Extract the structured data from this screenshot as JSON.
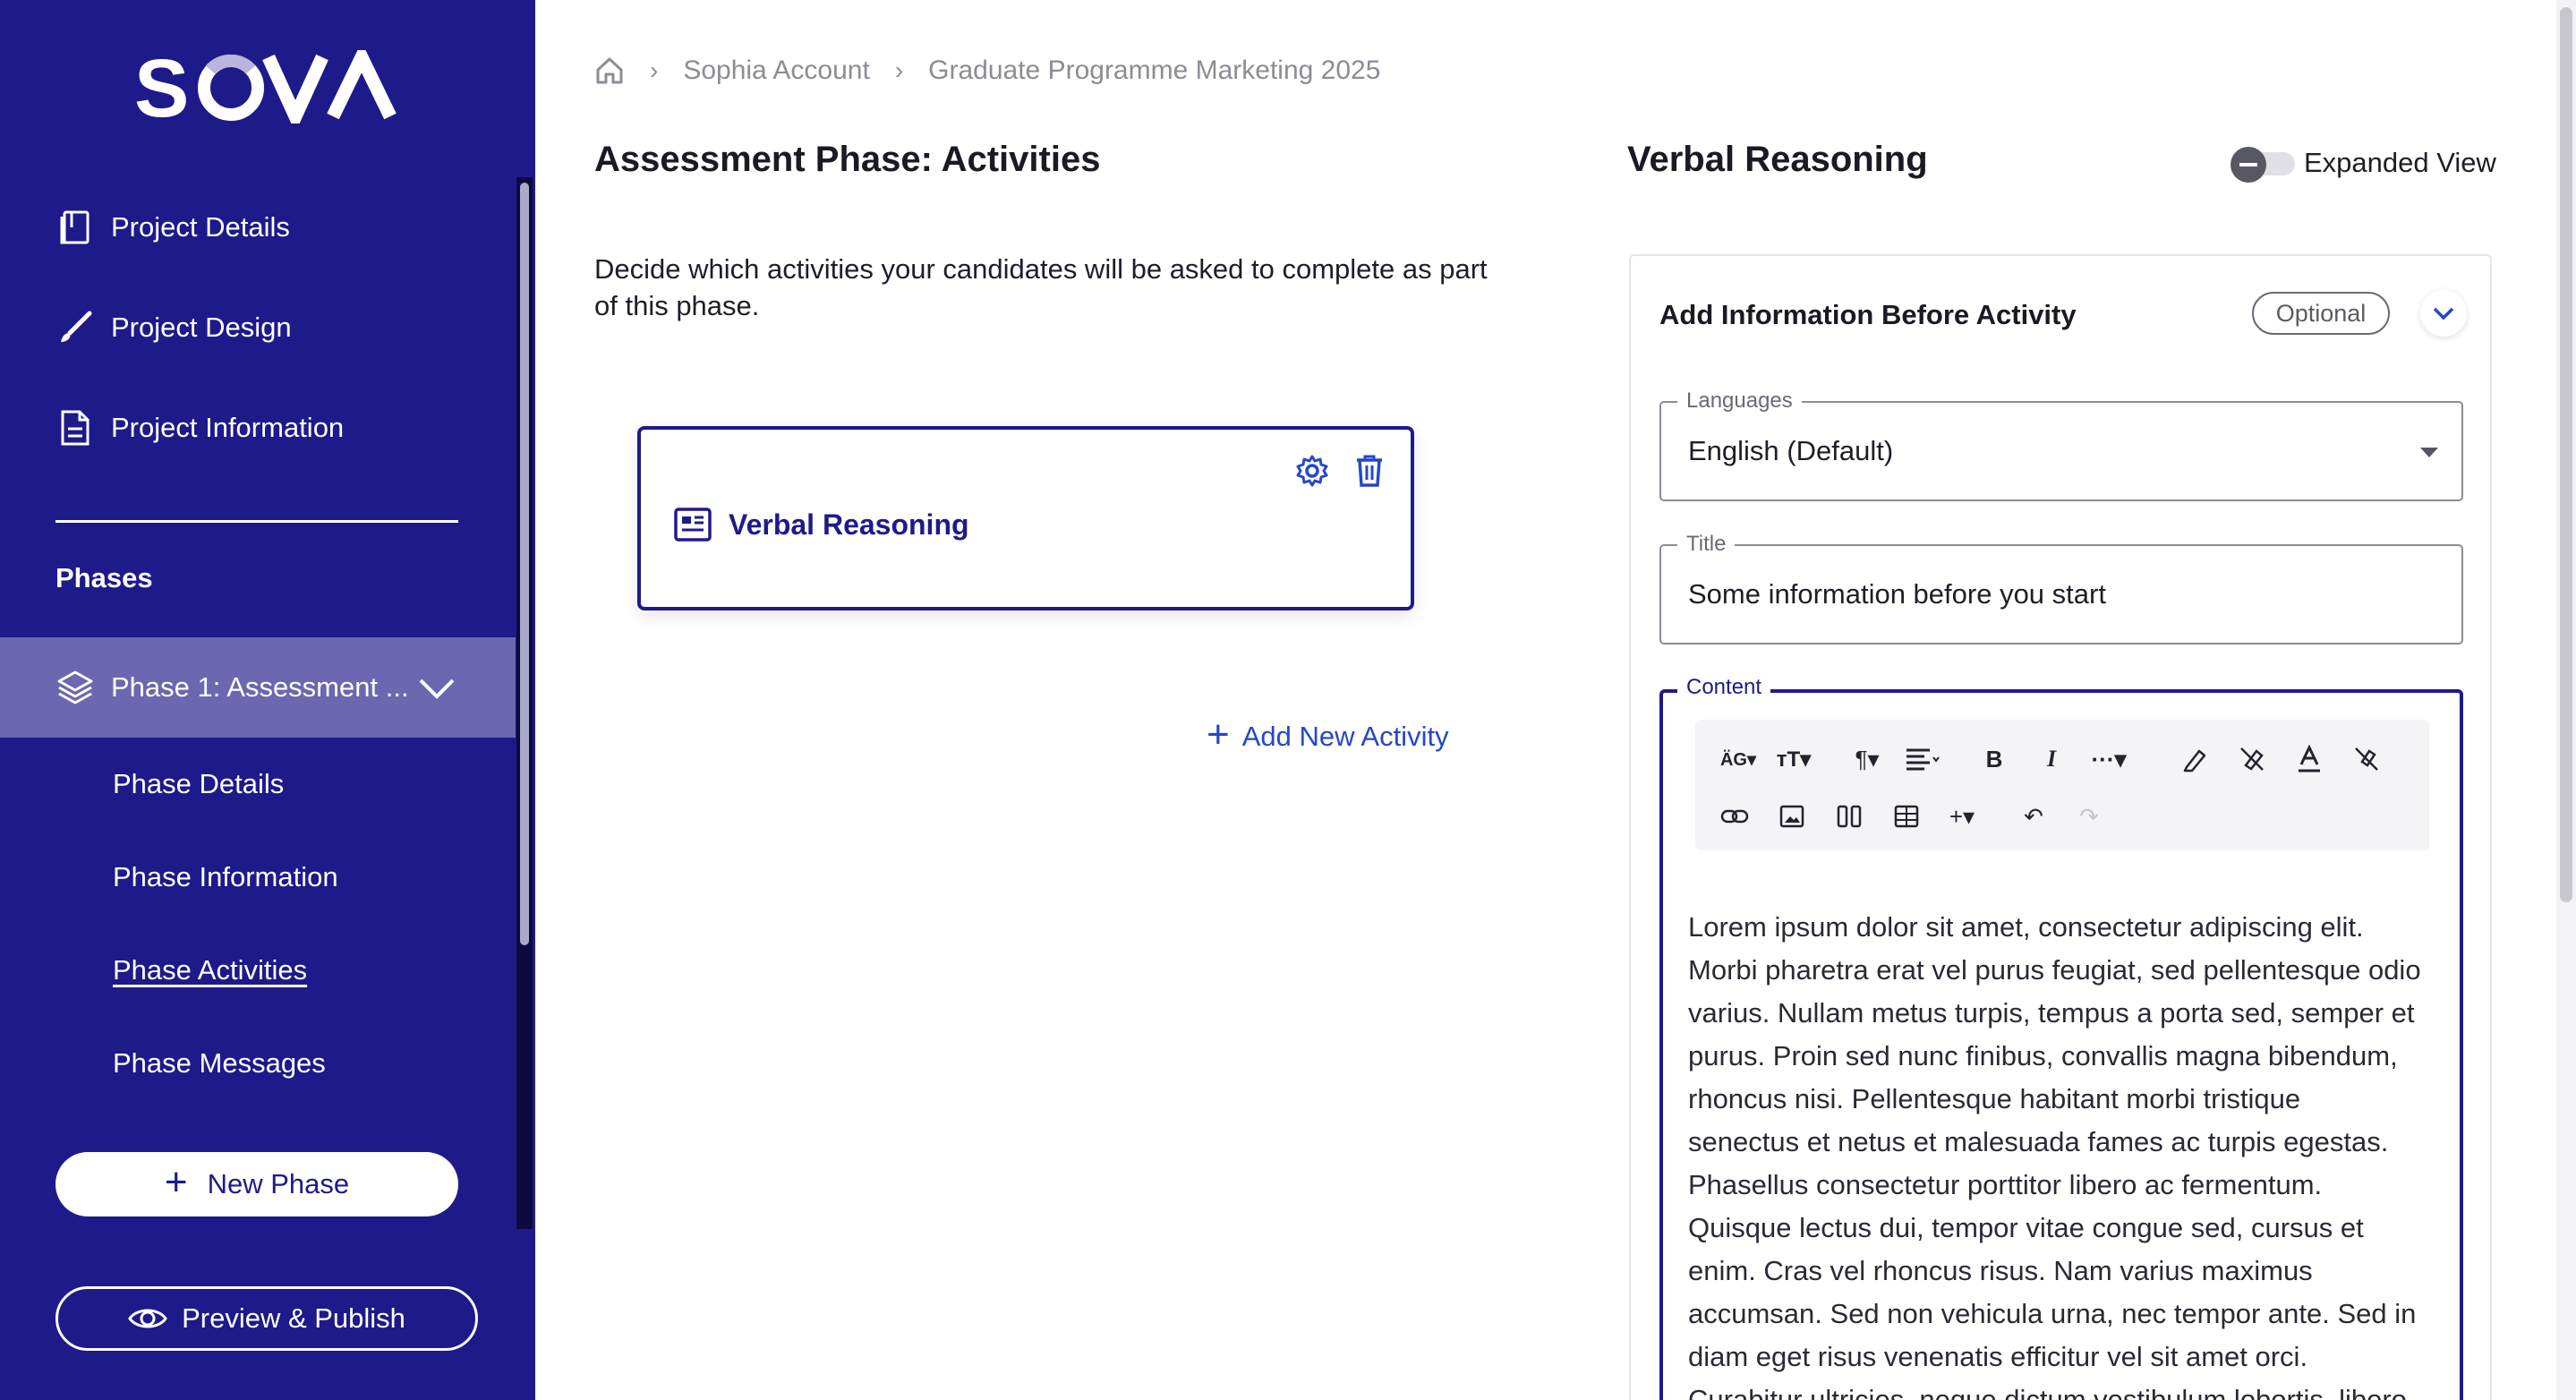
{
  "brand": {
    "name": "SOVA",
    "color": "#1e1a8a",
    "accent": "#2547c9"
  },
  "sidebar": {
    "items": [
      {
        "label": "Project Details",
        "icon": "book-icon"
      },
      {
        "label": "Project Design",
        "icon": "brush-icon"
      },
      {
        "label": "Project Information",
        "icon": "document-icon"
      }
    ],
    "phases_heading": "Phases",
    "phase": {
      "label": "Phase 1: Assessment ...",
      "icon": "layers-icon"
    },
    "phase_subitems": [
      {
        "label": "Phase Details"
      },
      {
        "label": "Phase Information"
      },
      {
        "label": "Phase Activities",
        "active": true
      },
      {
        "label": "Phase Messages"
      }
    ],
    "new_phase_label": "New Phase",
    "preview_label": "Preview & Publish"
  },
  "breadcrumb": [
    "Sophia Account",
    "Graduate Programme Marketing 2025"
  ],
  "main": {
    "title": "Assessment Phase: Activities",
    "description": "Decide which activities your candidates will be asked to complete as part of this phase.",
    "activity_card": {
      "label": "Verbal Reasoning"
    },
    "add_activity_label": "Add New Activity"
  },
  "panel": {
    "title": "Verbal Reasoning",
    "expanded_view_label": "Expanded View",
    "expanded_view_on": false,
    "section_title": "Add Information Before Activity",
    "optional_badge": "Optional",
    "languages_legend": "Languages",
    "language_value": "English (Default)",
    "title_legend": "Title",
    "title_value": "Some information before you start",
    "content_legend": "Content",
    "toolbar_row1": [
      "text-case-icon",
      "font-size-icon",
      "paragraph-icon",
      "align-icon",
      "bold-icon",
      "italic-icon",
      "more-icon",
      "highlight-icon",
      "clear-highlight-icon",
      "font-color-icon",
      "clear-format-icon"
    ],
    "toolbar_row2": [
      "link-icon",
      "image-icon",
      "columns-icon",
      "table-icon",
      "insert-icon",
      "undo-icon",
      "redo-icon"
    ],
    "content_lines": [
      "Lorem ipsum dolor sit amet, consectetur adipiscing elit.",
      "Morbi pharetra erat vel purus feugiat, sed pellentesque odio",
      "varius. Nullam metus turpis, tempus a porta sed, semper et",
      "purus. Proin sed nunc finibus, convallis magna bibendum,",
      "rhoncus nisi. Pellentesque habitant morbi tristique",
      "senectus et netus et malesuada fames ac turpis egestas.",
      "Phasellus consectetur porttitor libero ac fermentum.",
      "Quisque lectus dui, tempor vitae congue sed, cursus et",
      "enim. Cras vel rhoncus risus. Nam varius maximus",
      "accumsan. Sed non vehicula urna, nec tempor ante. Sed in",
      "diam eget risus venenatis efficitur vel sit amet orci.",
      "Curabitur ultricies, neque dictum vestibulum lobortis, libero"
    ]
  }
}
